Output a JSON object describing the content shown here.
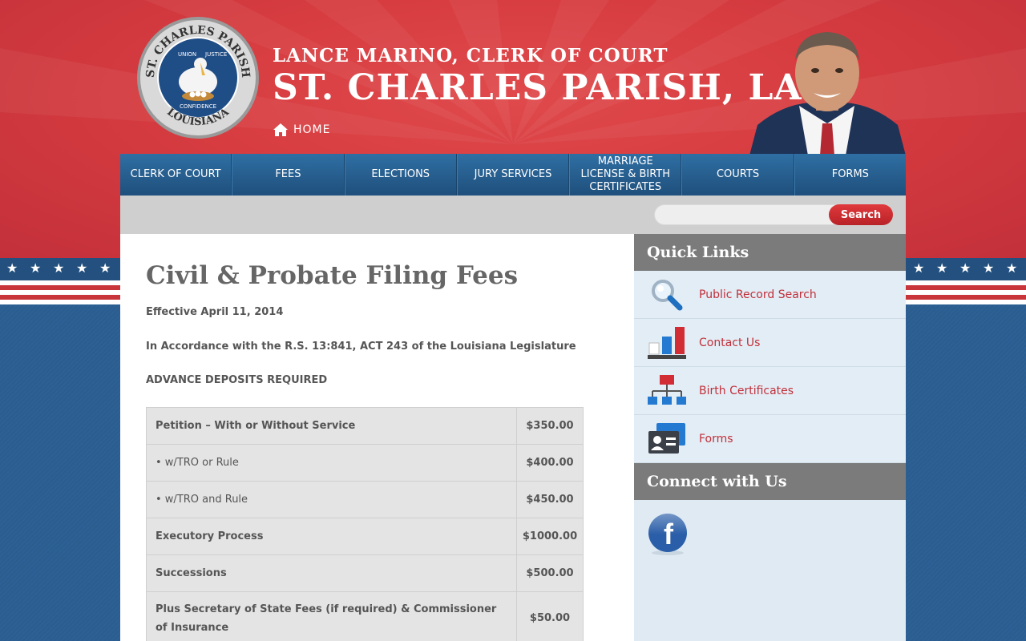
{
  "header": {
    "clerk_name": "LANCE MARINO, CLERK OF COURT",
    "site_title": "ST. CHARLES PARISH, LA",
    "home_label": "HOME",
    "seal_text": [
      "ST. CHARLES PARISH",
      "UNION",
      "JUSTICE",
      "CONFIDENCE",
      "LOUISIANA"
    ]
  },
  "nav": {
    "items": [
      {
        "label": "CLERK OF COURT"
      },
      {
        "label": "FEES"
      },
      {
        "label": "ELECTIONS"
      },
      {
        "label": "JURY SERVICES"
      },
      {
        "label": "MARRIAGE LICENSE & BIRTH CERTIFICATES"
      },
      {
        "label": "COURTS"
      },
      {
        "label": "FORMS"
      }
    ]
  },
  "search": {
    "placeholder": "",
    "button_label": "Search"
  },
  "main": {
    "title": "Civil & Probate Filing Fees",
    "effective": "Effective April 11, 2014",
    "accordance": "In Accordance with the R.S. 13:841, ACT 243 of the Louisiana Legislature",
    "deposits": "ADVANCE DEPOSITS REQUIRED",
    "fees": [
      {
        "desc": "Petition – With or Without Service",
        "amount": "$350.00"
      },
      {
        "desc": "• w/TRO or Rule",
        "amount": "$400.00"
      },
      {
        "desc": "• w/TRO and Rule",
        "amount": "$450.00"
      },
      {
        "desc": "Executory Process",
        "amount": "$1000.00"
      },
      {
        "desc": "Successions",
        "amount": "$500.00"
      },
      {
        "desc": "Plus Secretary of State Fees (if required) & Commissioner of Insurance",
        "amount": "$50.00"
      }
    ]
  },
  "sidebar": {
    "quick_links_title": "Quick Links",
    "quick_links": [
      {
        "label": "Public Record Search",
        "icon": "magnifier-icon"
      },
      {
        "label": "Contact Us",
        "icon": "bar-chart-icon"
      },
      {
        "label": "Birth Certificates",
        "icon": "org-chart-icon"
      },
      {
        "label": "Forms",
        "icon": "id-card-icon"
      }
    ],
    "connect_title": "Connect with Us",
    "facebook_glyph": "f"
  },
  "colors": {
    "header_red": "#d63c40",
    "nav_blue": "#2f6fa3",
    "link_red": "#c0303b",
    "sidebar_bg": "#dfeaf3",
    "sidebar_header": "#7b7b7b"
  }
}
